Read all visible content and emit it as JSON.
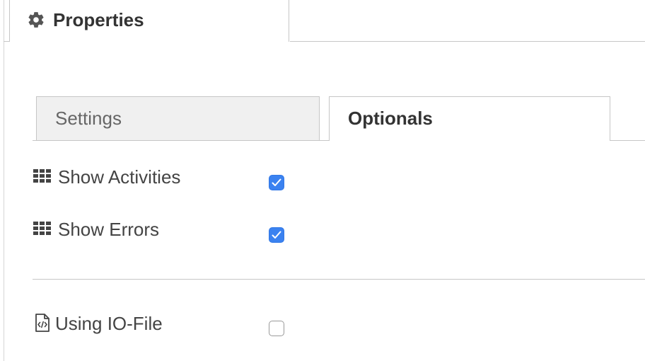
{
  "panel": {
    "title": "Properties",
    "title_icon": "gear-icon"
  },
  "tabs": [
    {
      "label": "Settings",
      "active": false
    },
    {
      "label": "Optionals",
      "active": true
    }
  ],
  "options": [
    {
      "label": "Show Activities",
      "icon": "grid-icon",
      "checked": true
    },
    {
      "label": "Show Errors",
      "icon": "grid-icon",
      "checked": true
    },
    {
      "label": "Using IO-File",
      "icon": "code-file-icon",
      "checked": false
    }
  ],
  "colors": {
    "checkbox_checked": "#3b82f0",
    "border": "#c6c6c6",
    "inactive_tab_bg": "#f0f0f0",
    "text": "#333333"
  }
}
